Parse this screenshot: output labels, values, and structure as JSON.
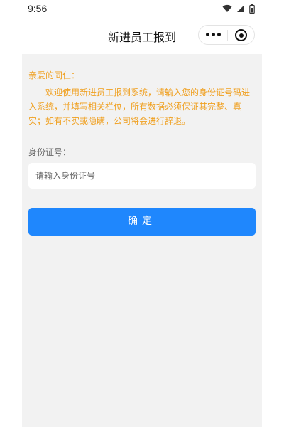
{
  "status_bar": {
    "time": "9:56"
  },
  "nav": {
    "title": "新进员工报到"
  },
  "notice": {
    "greeting": "亲爱的同仁：",
    "body": "欢迎使用新进员工报到系统，请输入您的身份证号码进入系统，并填写相关栏位，所有数据必须保证其完整、真实；如有不实或隐瞒，公司将会进行辞退。"
  },
  "form": {
    "id_label": "身份证号：",
    "id_placeholder": "请输入身份证号",
    "id_value": "",
    "confirm_label": "确定"
  },
  "colors": {
    "notice_text": "#f0a020",
    "primary_button": "#1f87fd",
    "page_background": "#f2f2f2"
  },
  "icons": {
    "status": [
      "wifi-icon",
      "signal-icon",
      "battery-icon"
    ],
    "capsule": [
      "more-icon",
      "close-miniprogram-icon"
    ]
  }
}
